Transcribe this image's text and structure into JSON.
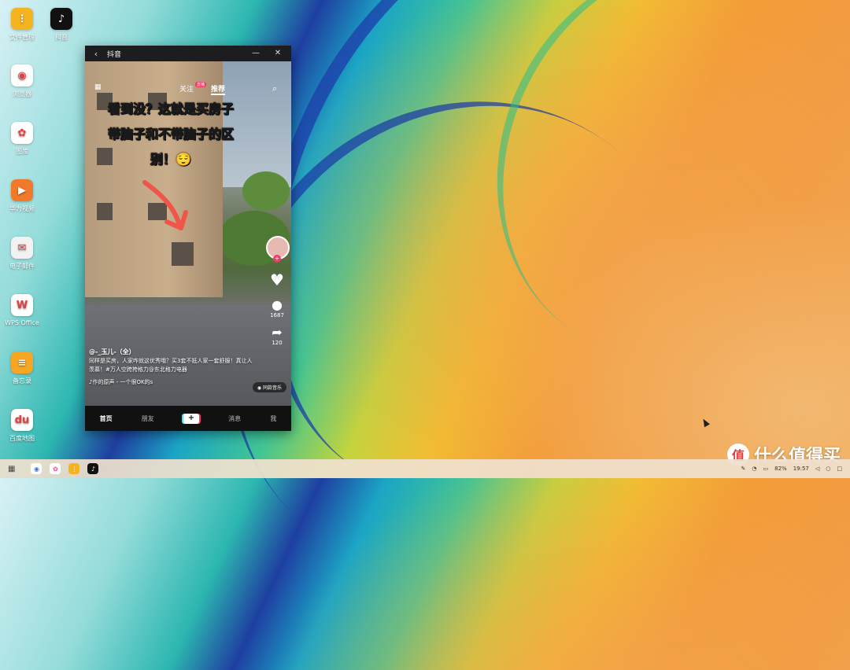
{
  "desktop": {
    "icons": [
      {
        "label": "文件管理",
        "icon": "folder-icon",
        "color": "#f5b320",
        "glyph": "⋮"
      },
      {
        "label": "抖音",
        "icon": "tiktok-icon",
        "color": "#111111",
        "glyph": "♪"
      },
      {
        "label": "浏览器",
        "icon": "browser-icon",
        "color": "#ffffff",
        "glyph": "◉"
      },
      {
        "label": "图库",
        "icon": "gallery-icon",
        "color": "#ffffff",
        "glyph": "✿"
      },
      {
        "label": "华为视频",
        "icon": "video-icon",
        "color": "#f07a2a",
        "glyph": "▶"
      },
      {
        "label": "电子邮件",
        "icon": "email-icon",
        "color": "#f2f2f2",
        "glyph": "✉"
      },
      {
        "label": "WPS Office",
        "icon": "wps-icon",
        "color": "#ffffff",
        "glyph": "W"
      },
      {
        "label": "备忘录",
        "icon": "memo-icon",
        "color": "#f5a623",
        "glyph": "≡"
      },
      {
        "label": "百度地图",
        "icon": "map-icon",
        "color": "#ffffff",
        "glyph": "du"
      }
    ]
  },
  "window": {
    "title": "抖音",
    "top_tabs": {
      "follow": "关注",
      "recommend": "推荐",
      "live_badge": "直播"
    },
    "caption_lines": [
      "看到没？这就是买房子",
      "带脑子和不带脑子的区",
      "别！😌"
    ],
    "counts": {
      "comments": "1687",
      "shares": "120"
    },
    "author": "@-_玉儿-（全）",
    "description": "同样是买房，人家咋就这优秀哦？买3套不抵人家一套舒服！真让人羡慕！#万人空跨挎格力@东北格力电器",
    "music": "♪作的原声 - 一个很OK的s",
    "same_music": "同款音乐",
    "nav": [
      "首页",
      "朋友",
      "+",
      "消息",
      "我"
    ]
  },
  "taskbar": {
    "battery": "82%",
    "time": "19:57"
  },
  "watermark": {
    "badge": "值",
    "text": "什么值得买"
  }
}
